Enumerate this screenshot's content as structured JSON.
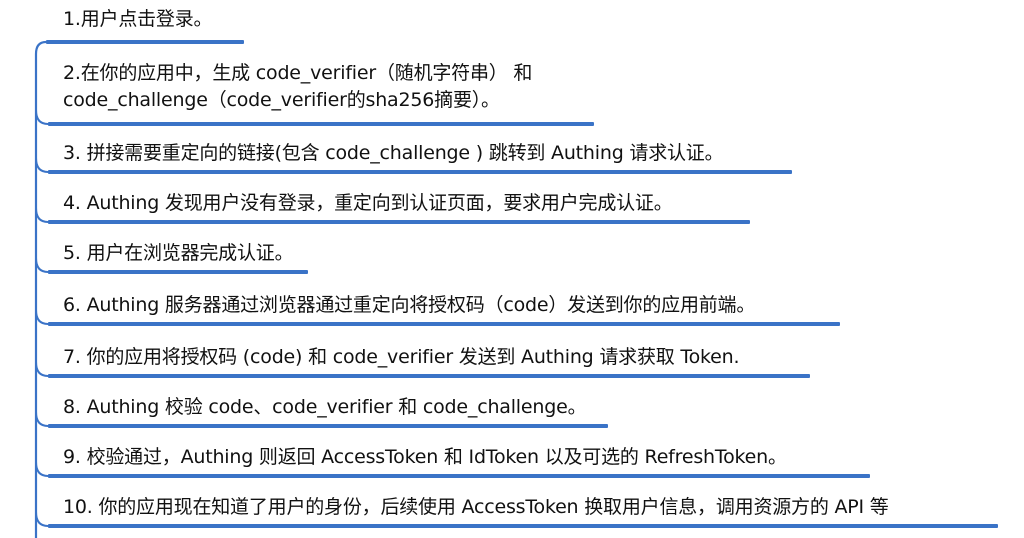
{
  "accent_color": "#3a73c7",
  "steps": [
    {
      "lines": [
        "1.用户点击登录。"
      ]
    },
    {
      "lines": [
        "2.在你的应用中，生成 code_verifier（随机字符串） 和",
        "code_challenge（code_verifier的sha256摘要）。"
      ]
    },
    {
      "lines": [
        "3. 拼接需要重定向的链接(包含 code_challenge ) 跳转到 Authing 请求认证。"
      ]
    },
    {
      "lines": [
        "4. Authing 发现用户没有登录，重定向到认证页面，要求用户完成认证。"
      ]
    },
    {
      "lines": [
        "5. 用户在浏览器完成认证。"
      ]
    },
    {
      "lines": [
        "6. Authing 服务器通过浏览器通过重定向将授权码（code）发送到你的应用前端。"
      ]
    },
    {
      "lines": [
        "7. 你的应用将授权码 (code) 和 code_verifier 发送到 Authing 请求获取 Token."
      ]
    },
    {
      "lines": [
        "8. Authing 校验 code、code_verifier 和 code_challenge。"
      ]
    },
    {
      "lines": [
        "9. 校验通过，Authing 则返回 AccessToken 和 IdToken 以及可选的 RefreshToken。"
      ]
    },
    {
      "lines": [
        "10. 你的应用现在知道了用户的身份，后续使用 AccessToken 换取用户信息，调用资源方的 API 等"
      ]
    }
  ]
}
